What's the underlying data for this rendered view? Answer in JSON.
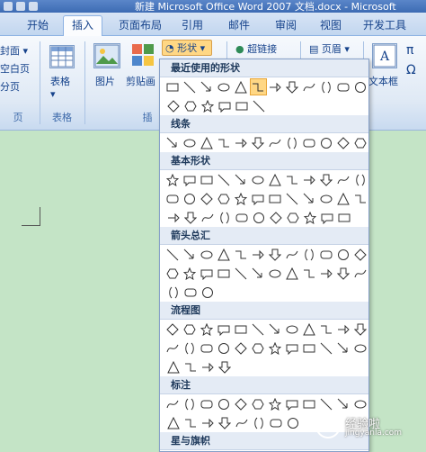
{
  "title_bar": {
    "text": "新建 Microsoft Office Word 2007 文档.docx - Microsoft"
  },
  "tabs": [
    {
      "label": "开始"
    },
    {
      "label": "插入",
      "active": true
    },
    {
      "label": "页面布局"
    },
    {
      "label": "引用"
    },
    {
      "label": "邮件"
    },
    {
      "label": "审阅"
    },
    {
      "label": "视图"
    },
    {
      "label": "开发工具"
    }
  ],
  "ribbon": {
    "pages": {
      "cover": "封面",
      "blank": "空白页",
      "break": "分页",
      "group": "页"
    },
    "table": {
      "button": "表格",
      "group": "表格"
    },
    "illustrations": {
      "picture": "图片",
      "clipart": "剪贴画",
      "shapes": "形状",
      "group": "插"
    },
    "links": {
      "hyperlink": "超链接"
    },
    "header": {
      "button": "页眉"
    },
    "text": {
      "textbox": "文本框"
    }
  },
  "gallery": {
    "sections": [
      {
        "title": "最近使用的形状",
        "rows": [
          12,
          6
        ]
      },
      {
        "title": "线条",
        "rows": [
          12
        ]
      },
      {
        "title": "基本形状",
        "rows": [
          12,
          12,
          11
        ]
      },
      {
        "title": "箭头总汇",
        "rows": [
          12,
          12,
          3
        ]
      },
      {
        "title": "流程图",
        "rows": [
          12,
          12,
          4
        ]
      },
      {
        "title": "标注",
        "rows": [
          12,
          8
        ]
      },
      {
        "title": "星与旗帜",
        "rows": [
          12
        ]
      }
    ]
  },
  "watermark": {
    "text": "经验啦",
    "url": "jingyanla.com"
  },
  "colors": {
    "accent": "#15428b",
    "document_bg": "#c4e4c6",
    "selected_shape": "#ffd784"
  }
}
